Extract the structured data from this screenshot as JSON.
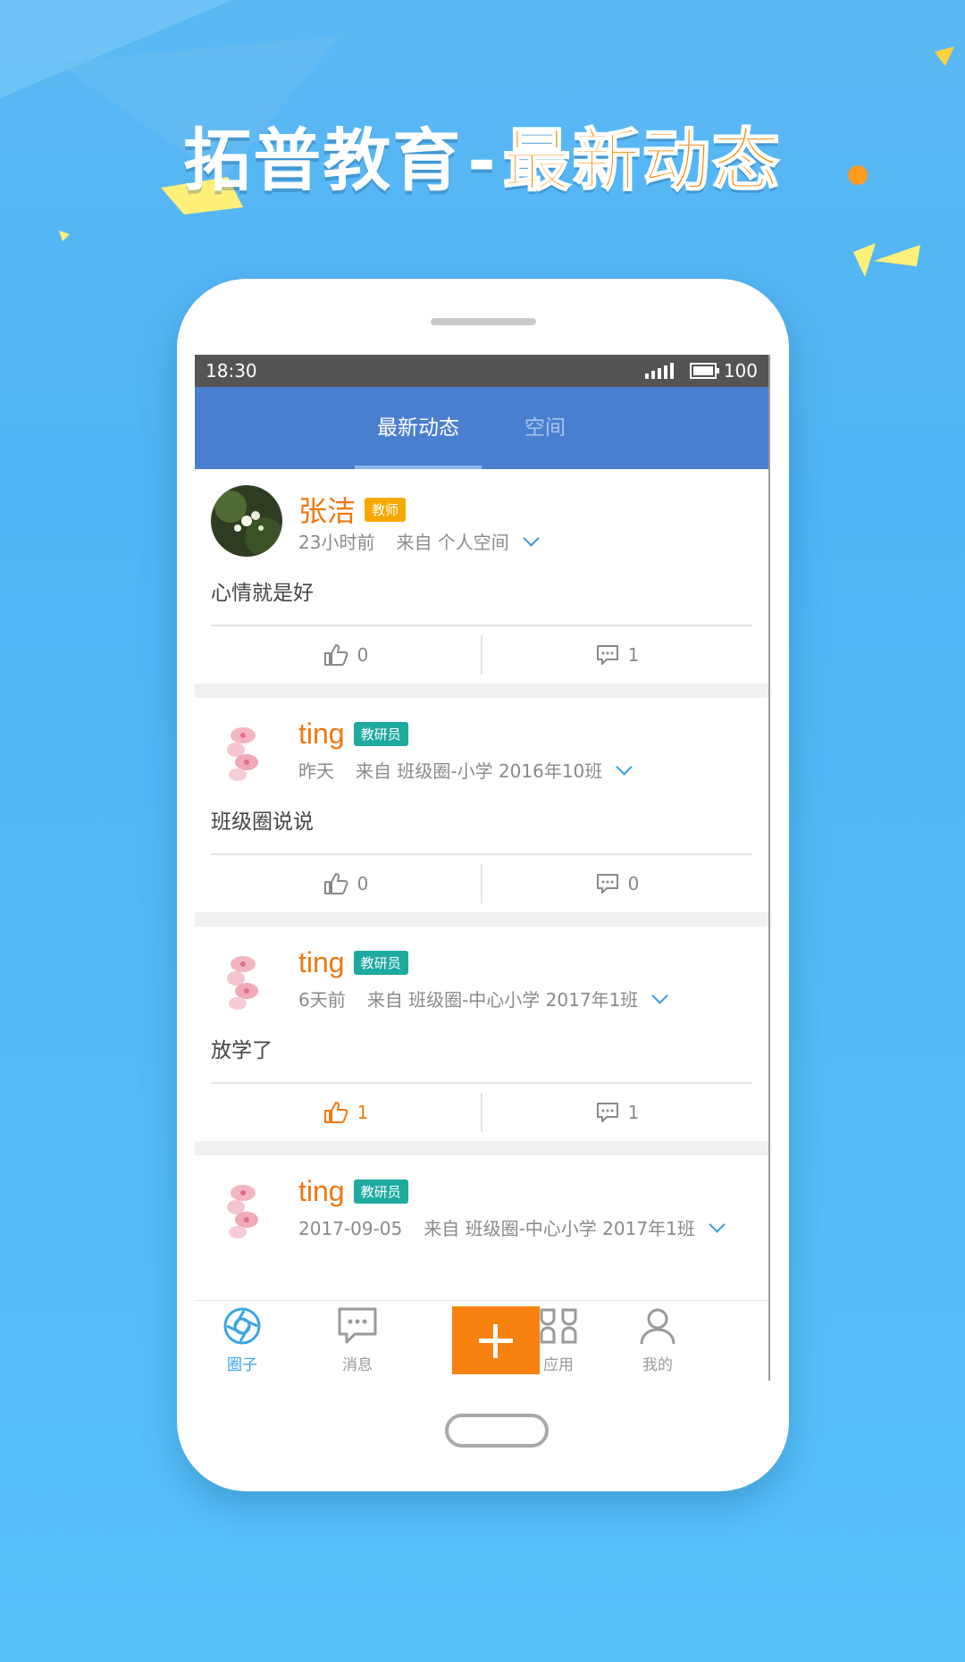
{
  "banner": {
    "title_main": "拓普教育",
    "title_dash": "-",
    "title_accent": "最新动态"
  },
  "status_bar": {
    "time": "18:30",
    "battery": "100"
  },
  "tabs": [
    {
      "label": "最新动态",
      "active": true
    },
    {
      "label": "空间",
      "active": false
    }
  ],
  "posts": [
    {
      "author": "张洁",
      "role": "教师",
      "time": "23小时前",
      "source": "来自 个人空间",
      "content": "心情就是好",
      "likes": "0",
      "comments": "1",
      "liked": false
    },
    {
      "author": "ting",
      "role": "教研员",
      "time": "昨天",
      "source": "来自 班级圈-小学 2016年10班",
      "content": "班级圈说说",
      "likes": "0",
      "comments": "0",
      "liked": false
    },
    {
      "author": "ting",
      "role": "教研员",
      "time": "6天前",
      "source": "来自 班级圈-中心小学 2017年1班",
      "content": "放学了",
      "likes": "1",
      "comments": "1",
      "liked": true
    },
    {
      "author": "ting",
      "role": "教研员",
      "time": "2017-09-05",
      "source": "来自 班级圈-中心小学 2017年1班",
      "content": "",
      "likes": "",
      "comments": "",
      "liked": false
    }
  ],
  "bottom_nav": [
    {
      "label": "圈子",
      "icon": "aperture-icon",
      "active": true
    },
    {
      "label": "消息",
      "icon": "chat-bubble-icon",
      "active": false
    },
    {
      "label": "",
      "icon": "plus-icon",
      "active": false
    },
    {
      "label": "应用",
      "icon": "apps-grid-icon",
      "active": false
    },
    {
      "label": "我的",
      "icon": "person-icon",
      "active": false
    }
  ],
  "colors": {
    "accent_orange": "#f07810",
    "header_blue": "#4a7fd0",
    "teacher_badge": "#f7a800",
    "researcher_badge": "#1faaa0",
    "background_blue": "#58c2fb"
  }
}
